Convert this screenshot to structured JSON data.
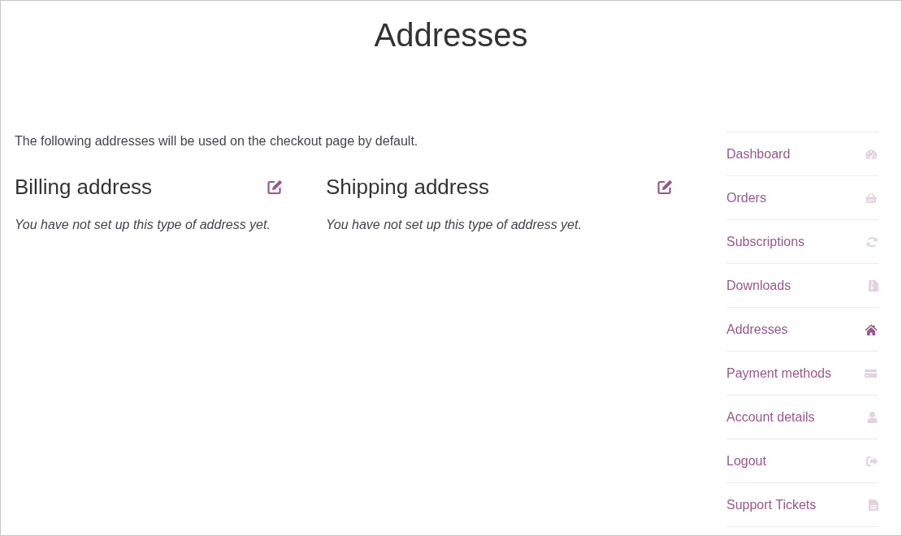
{
  "page": {
    "title": "Addresses"
  },
  "content": {
    "intro": "The following addresses will be used on the checkout page by default.",
    "addresses": [
      {
        "heading": "Billing address",
        "message": "You have not set up this type of address yet."
      },
      {
        "heading": "Shipping address",
        "message": "You have not set up this type of address yet."
      }
    ]
  },
  "sidebar": {
    "items": [
      {
        "label": "Dashboard",
        "selected": false
      },
      {
        "label": "Orders",
        "selected": false
      },
      {
        "label": "Subscriptions",
        "selected": false
      },
      {
        "label": "Downloads",
        "selected": false
      },
      {
        "label": "Addresses",
        "selected": true
      },
      {
        "label": "Payment methods",
        "selected": false
      },
      {
        "label": "Account details",
        "selected": false
      },
      {
        "label": "Logout",
        "selected": false
      },
      {
        "label": "Support Tickets",
        "selected": false
      }
    ]
  }
}
